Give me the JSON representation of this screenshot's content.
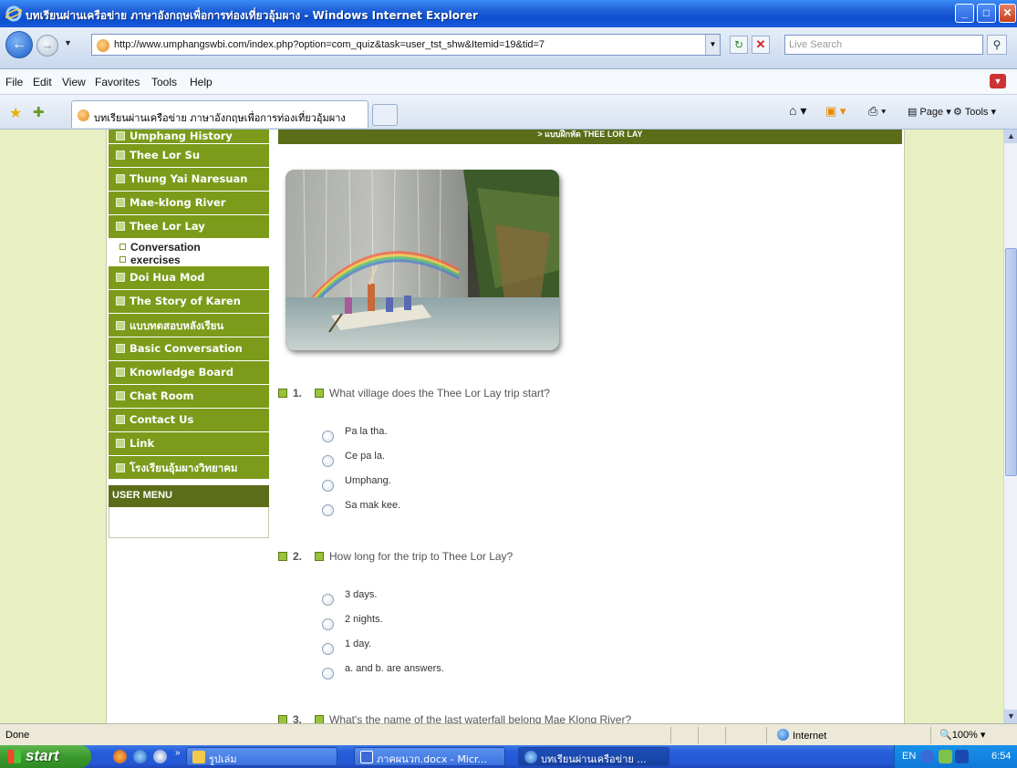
{
  "window": {
    "title": "บทเรียนผ่านเครือข่าย ภาษาอังกฤษเพื่อการท่องเที่ยวอุ้มผาง - Windows Internet Explorer",
    "minimize": "_",
    "maximize": "□",
    "close": "✕"
  },
  "address": {
    "url": "http://www.umphangswbi.com/index.php?option=com_quiz&task=user_tst_shw&Itemid=19&tid=7",
    "search_placeholder": "Live Search"
  },
  "menu": {
    "items": [
      "File",
      "Edit",
      "View",
      "Favorites",
      "Tools",
      "Help"
    ]
  },
  "tabs": {
    "active_label": "บทเรียนผ่านเครือข่าย ภาษาอังกฤษเพื่อการท่องเที่ยวอุ้มผาง",
    "page_label": "Page",
    "tools_label": "Tools"
  },
  "sidebar": {
    "items": [
      "Umphang History",
      "Thee Lor Su",
      "Thung Yai Naresuan",
      "Mae-klong River",
      "Thee Lor Lay"
    ],
    "sub_items": [
      "Conversation",
      "exercises"
    ],
    "items_after": [
      "Doi Hua Mod",
      "The Story of Karen",
      "แบบทดสอบหลังเรียน",
      "Basic Conversation",
      "Knowledge Board",
      "Chat Room",
      "Contact Us",
      "Link",
      "โรงเรียนอุ้มผางวิทยาคม"
    ],
    "user_menu": "USER MENU"
  },
  "content": {
    "header": "> แบบฝึกหัด THEE LOR LAY",
    "questions": [
      {
        "num": "1.",
        "text": "What village does the Thee Lor Lay trip start?",
        "options": [
          "Pa la tha.",
          "Ce pa la.",
          "Umphang.",
          "Sa mak kee."
        ]
      },
      {
        "num": "2.",
        "text": "How long for the trip to Thee Lor Lay?",
        "options": [
          "3 days.",
          "2 nights.",
          "1 day.",
          "a. and b. are answers."
        ]
      },
      {
        "num": "3.",
        "text": "What's the name of the last waterfall belong Mae Klong River?",
        "options": []
      }
    ]
  },
  "status": {
    "text": "Done",
    "zone": "Internet",
    "zoom": "100%"
  },
  "taskbar": {
    "start": "start",
    "tasks": [
      "รูปเล่ม",
      "ภาคผนวก.docx - Micr...",
      "บทเรียนผ่านเครือข่าย ..."
    ],
    "lang": "EN",
    "clock": "6:54"
  }
}
